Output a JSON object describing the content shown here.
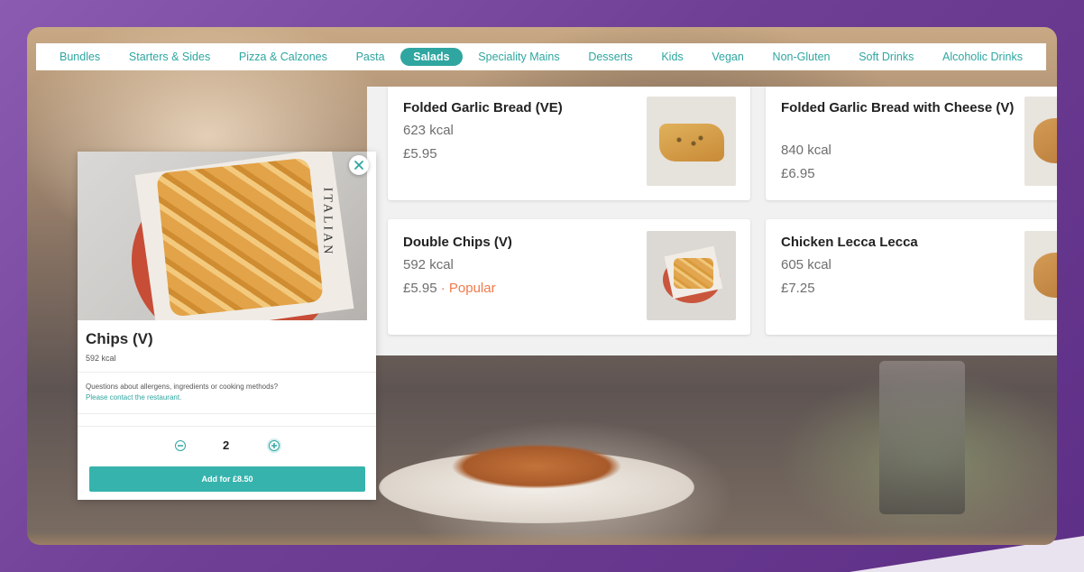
{
  "nav": {
    "items": [
      {
        "label": "Bundles"
      },
      {
        "label": "Starters & Sides"
      },
      {
        "label": "Pizza & Calzones"
      },
      {
        "label": "Pasta"
      },
      {
        "label": "Salads",
        "active": true
      },
      {
        "label": "Speciality Mains"
      },
      {
        "label": "Desserts"
      },
      {
        "label": "Kids"
      },
      {
        "label": "Vegan"
      },
      {
        "label": "Non-Gluten"
      },
      {
        "label": "Soft Drinks"
      },
      {
        "label": "Alcoholic Drinks"
      }
    ]
  },
  "menu": {
    "cards": [
      {
        "name": "Folded Garlic Bread (VE)",
        "kcal": "623 kcal",
        "price": "£5.95",
        "badge": ""
      },
      {
        "name": "Folded Garlic Bread with Cheese (V)",
        "kcal": "840 kcal",
        "price": "£6.95",
        "badge": ""
      },
      {
        "name": "Double Chips (V)",
        "kcal": "592 kcal",
        "price": "£5.95",
        "badge": "· Popular"
      },
      {
        "name": "Chicken Lecca Lecca",
        "kcal": "605 kcal",
        "price": "£7.25",
        "badge": ""
      }
    ]
  },
  "popup": {
    "title": "Chips (V)",
    "kcal": "592 kcal",
    "question": "Questions about allergens, ingredients or cooking methods?",
    "link": "Please contact the restaurant.",
    "quantity": "2",
    "add_label": "Add for £8.50",
    "photo_text": "ITALIAN"
  },
  "colors": {
    "accent": "#2fa6a0",
    "popular": "#f07b4d",
    "frame": "#6b3f8f"
  },
  "icons": {
    "close": "close-icon",
    "minus": "minus-circle-icon",
    "plus": "plus-circle-icon"
  }
}
